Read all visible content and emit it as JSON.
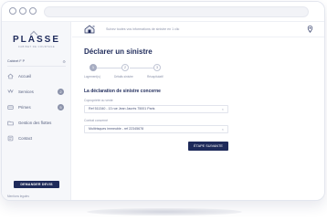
{
  "brand": {
    "name": "PLASSE",
    "tagline": "CABINET DE COURTAGE"
  },
  "sidebar": {
    "account_label": "Cabinet F P",
    "items": [
      {
        "label": "Accueil",
        "icon": "home-icon"
      },
      {
        "label": "Services",
        "icon": "services-icon",
        "badge": "2"
      },
      {
        "label": "Primes",
        "icon": "wallet-icon",
        "badge": "5"
      },
      {
        "label": "Gestion des flottes",
        "icon": "folder-icon"
      },
      {
        "label": "Contact",
        "icon": "contact-icon"
      }
    ],
    "claim_button_label": "DEMANDER DEVIS",
    "footer_text": "Mentions legales"
  },
  "topbar": {
    "notice": "Suivez toutes vos informations de sinistre en 1 clic"
  },
  "page": {
    "title": "Déclarer un sinistre",
    "steps": [
      {
        "number": "1",
        "label": "Logement(s)"
      },
      {
        "number": "2",
        "label": "Détails sinistre"
      },
      {
        "number": "3",
        "label": "Récapitulatif"
      }
    ],
    "section_title": "La déclaration de sinistre concerne",
    "fields": [
      {
        "label": "Copropriété ou vente",
        "value": "Ref 511340 - 13 rue Jean Jaurès 75001 Paris"
      },
      {
        "label": "Contrat concerné",
        "value": "Multirisques immeuble - ref 22345678"
      }
    ],
    "submit_label": "ÉTAPE SUIVANTE"
  },
  "colors": {
    "navy": "#1e2a5a",
    "muted": "#8b92aa",
    "sidebar_bg": "#f6f7fa"
  }
}
